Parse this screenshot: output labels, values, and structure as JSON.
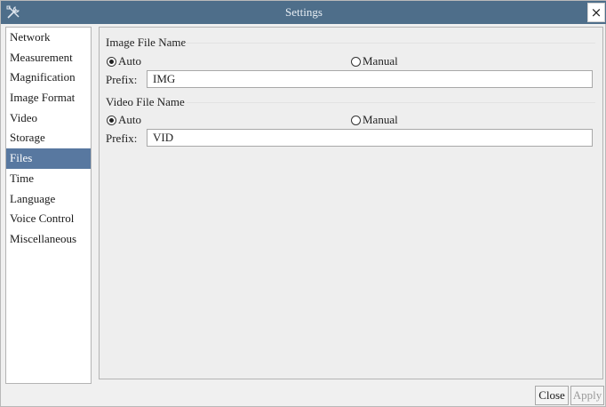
{
  "window": {
    "title": "Settings"
  },
  "titlebar": {
    "app_icon": "tools-icon",
    "close_icon": "close-icon",
    "close_glyph": "×"
  },
  "nav": {
    "items": [
      {
        "label": "Network"
      },
      {
        "label": "Measurement"
      },
      {
        "label": "Magnification"
      },
      {
        "label": "Image Format"
      },
      {
        "label": "Video"
      },
      {
        "label": "Storage"
      },
      {
        "label": "Files",
        "selected": true
      },
      {
        "label": "Time"
      },
      {
        "label": "Language"
      },
      {
        "label": "Voice Control"
      },
      {
        "label": "Miscellaneous"
      }
    ],
    "selected_color": "#5878a0"
  },
  "image_file": {
    "title": "Image File Name",
    "auto_label": "Auto",
    "manual_label": "Manual",
    "selected": "Auto",
    "prefix_label": "Prefix:",
    "prefix_value": "IMG"
  },
  "video_file": {
    "title": "Video File Name",
    "auto_label": "Auto",
    "manual_label": "Manual",
    "selected": "Auto",
    "prefix_label": "Prefix:",
    "prefix_value": "VID"
  },
  "footer": {
    "close_label": "Close",
    "apply_label": "Apply",
    "apply_enabled": false
  },
  "colors": {
    "titlebar": "#4e6e8a",
    "selection": "#5878a0"
  }
}
